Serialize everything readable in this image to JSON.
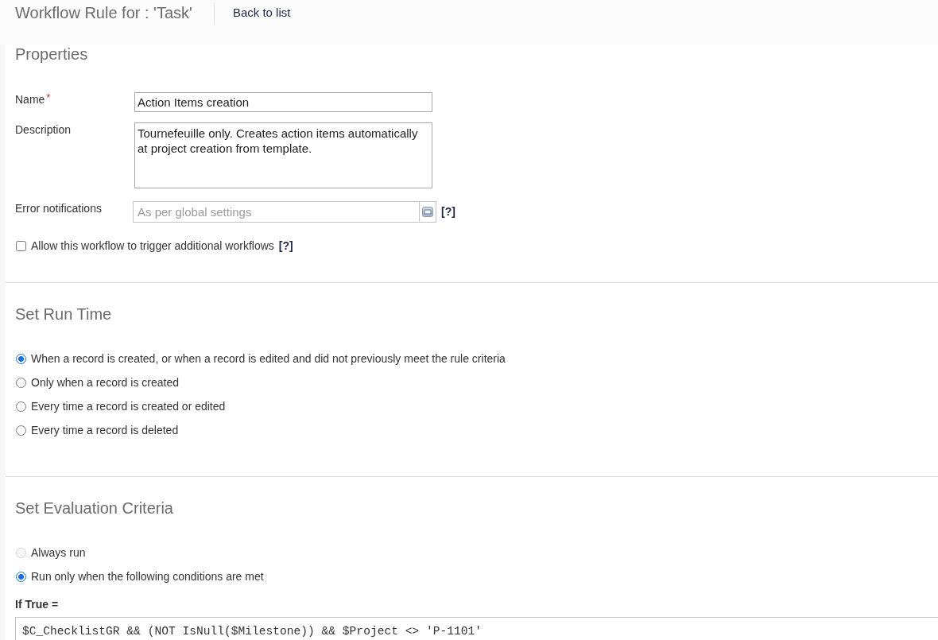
{
  "header": {
    "title": "Workflow Rule for : 'Task'",
    "back_link": "Back to list"
  },
  "properties": {
    "title": "Properties",
    "name_field": {
      "label": "Name",
      "required_mark": "*",
      "value": "Action Items creation"
    },
    "description_field": {
      "label": "Description",
      "value": "Tournefeuille only. Creates action items automatically at project creation from template."
    },
    "error_notifications": {
      "label": "Error notifications",
      "placeholder": "As per global settings",
      "help": "[?]"
    },
    "allow_trigger": {
      "label": "Allow this workflow to trigger additional workflows",
      "checked": false,
      "help": "[?]"
    }
  },
  "run_time": {
    "title": "Set Run Time",
    "options": [
      {
        "label": "When a record is created, or when a record is edited and did not previously meet the rule criteria",
        "selected": true
      },
      {
        "label": "Only when a record is created",
        "selected": false
      },
      {
        "label": "Every time a record is created or edited",
        "selected": false
      },
      {
        "label": "Every time a record is deleted",
        "selected": false
      }
    ]
  },
  "evaluation_criteria": {
    "title": "Set Evaluation Criteria",
    "options": [
      {
        "label": "Always run",
        "selected": false,
        "disabled": true
      },
      {
        "label": "Run only when the following conditions are met",
        "selected": true,
        "disabled": false
      }
    ],
    "condition_label": "If True =",
    "condition": "$C_ChecklistGR && (NOT IsNull($Milestone)) && $Project <> 'P-1101'"
  }
}
